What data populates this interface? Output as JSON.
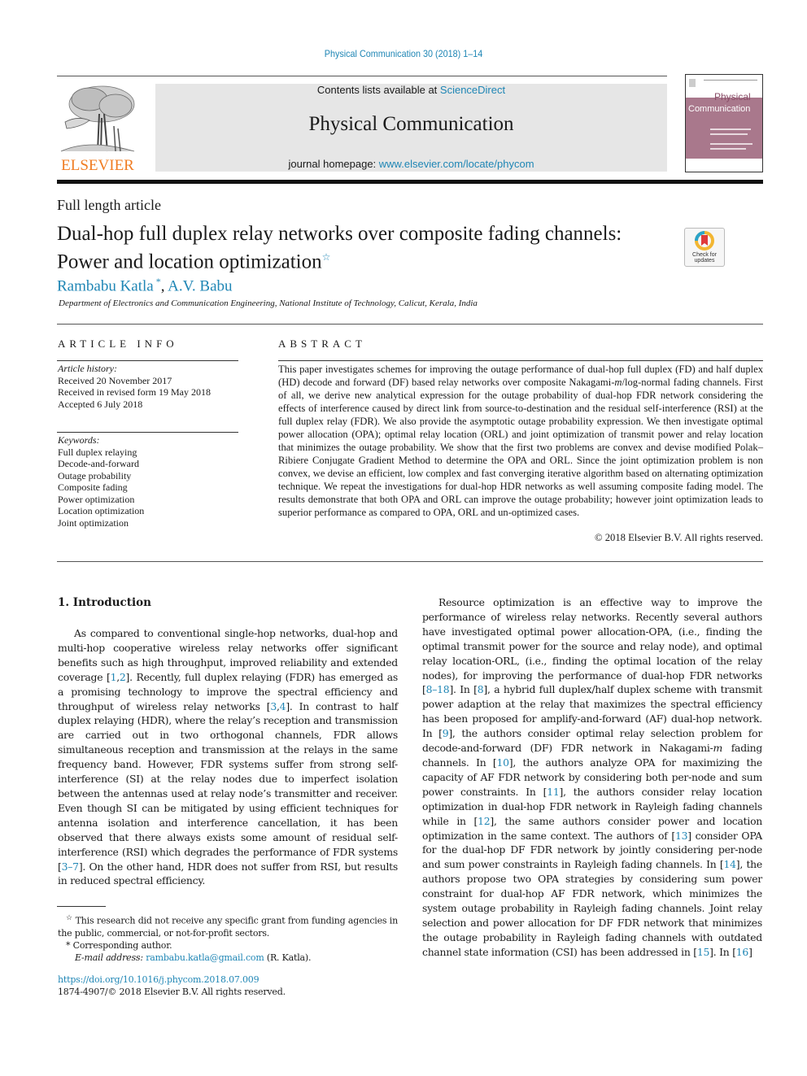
{
  "header": {
    "journal_ref": "Physical Communication 30 (2018) 1–14",
    "contents_prefix": "Contents lists available at ",
    "contents_link": "ScienceDirect",
    "journal_title": "Physical Communication",
    "homepage_prefix": "journal homepage: ",
    "homepage_link": "www.elsevier.com/locate/phycom",
    "publisher_logo_text": "ELSEVIER",
    "cover": {
      "title_line1": "Physical",
      "title_line2": "Communication"
    },
    "brand_color": "#f07c22",
    "link_color": "#1f86b5"
  },
  "article": {
    "type": "Full length article",
    "title_line1": "Dual-hop full duplex relay networks over composite fading channels:",
    "title_line2": "Power and location optimization",
    "title_footnote_mark": "☆",
    "check_updates_label_1": "Check for",
    "check_updates_label_2": "updates",
    "authors": [
      {
        "name": "Rambabu Katla",
        "mark": "*"
      },
      {
        "name": "A.V. Babu",
        "mark": ""
      }
    ],
    "author_separator": ", ",
    "affiliation": "Department of Electronics and Communication Engineering, National Institute of Technology, Calicut, Kerala, India"
  },
  "article_info": {
    "heading": "ARTICLE INFO",
    "history_label": "Article history:",
    "history": [
      "Received 20 November 2017",
      "Received in revised form 19 May 2018",
      "Accepted 6 July 2018"
    ],
    "keywords_label": "Keywords:",
    "keywords": [
      "Full duplex relaying",
      "Decode-and-forward",
      "Outage probability",
      "Composite fading",
      "Power optimization",
      "Location optimization",
      "Joint optimization"
    ]
  },
  "abstract": {
    "heading": "ABSTRACT",
    "text_part1": "This paper investigates schemes for improving the outage performance of dual-hop full duplex (FD) and half duplex (HD) decode and forward (DF) based relay networks over composite Nakagami-",
    "text_italic": "m",
    "text_part2": "/log-normal fading channels. First of all, we derive new analytical expression for the outage probability of dual-hop FDR network considering the effects of interference caused by direct link from source-to-destination and the residual self-interference (RSI) at the full duplex relay (FDR). We also provide the asymptotic outage probability expression. We then investigate optimal power allocation (OPA); optimal relay location (ORL) and joint optimization of transmit power and relay location that minimizes the outage probability. We show that the first two problems are convex and devise modified Polak–Ribiere Conjugate Gradient Method to determine the OPA and ORL. Since the joint optimization problem is non convex, we devise an efficient, low complex and fast converging iterative algorithm based on alternating optimization technique. We repeat the investigations for dual-hop HDR networks as well assuming composite fading model. The results demonstrate that both OPA and ORL can improve the outage probability; however joint optimization leads to superior performance as compared to OPA, ORL and un-optimized cases.",
    "copyright": "© 2018 Elsevier B.V. All rights reserved."
  },
  "introduction": {
    "heading": "1.  Introduction",
    "left_paragraph": [
      {
        "t": "As compared to conventional single-hop networks, dual-hop and multi-hop cooperative wireless relay networks offer significant benefits such as high throughput, improved reliability and extended coverage ["
      },
      {
        "ref": "1"
      },
      {
        "t": ","
      },
      {
        "ref": "2"
      },
      {
        "t": "]. Recently, full duplex relaying (FDR) has emerged as a promising technology to improve the spectral efficiency and throughput of wireless relay networks ["
      },
      {
        "ref": "3"
      },
      {
        "t": ","
      },
      {
        "ref": "4"
      },
      {
        "t": "]. In contrast to half duplex relaying (HDR), where the relay’s reception and transmission are carried out in two orthogonal channels, FDR allows simultaneous reception and transmission at the relays in the same frequency band. However, FDR systems suffer from strong self-interference (SI) at the relay nodes due to imperfect isolation between the antennas used at relay node’s transmitter and receiver. Even though SI can be mitigated by using efficient techniques for antenna isolation and interference cancellation, it has been observed that there always exists some amount of residual self-interference (RSI) which degrades the performance of FDR systems ["
      },
      {
        "ref": "3–7"
      },
      {
        "t": "]. On the other hand, HDR does not suffer from RSI, but results in reduced spectral efficiency."
      }
    ],
    "right_paragraph": [
      {
        "t": "Resource optimization is an effective way to improve the performance of wireless relay networks. Recently several authors have investigated optimal power allocation-OPA, (i.e., finding the optimal transmit power for the source and relay node), and optimal relay location-ORL, (i.e., finding the optimal location of the relay nodes), for improving the performance of dual-hop FDR networks ["
      },
      {
        "ref": "8–18"
      },
      {
        "t": "]. In ["
      },
      {
        "ref": "8"
      },
      {
        "t": "], a hybrid full duplex/half duplex scheme with transmit power adaption at the relay that maximizes the spectral efficiency has been proposed for amplify-and-forward (AF) dual-hop network. In ["
      },
      {
        "ref": "9"
      },
      {
        "t": "], the authors consider optimal relay selection problem for decode-and-forward (DF) FDR network in Nakagami-"
      },
      {
        "i": "m"
      },
      {
        "t": " fading channels. In ["
      },
      {
        "ref": "10"
      },
      {
        "t": "], the authors analyze OPA for maximizing the capacity of AF FDR network by considering both per-node and sum power constraints. In ["
      },
      {
        "ref": "11"
      },
      {
        "t": "], the authors consider relay location optimization in dual-hop FDR network in Rayleigh fading channels while in ["
      },
      {
        "ref": "12"
      },
      {
        "t": "], the same authors consider power and location optimization in the same context. The authors of ["
      },
      {
        "ref": "13"
      },
      {
        "t": "] consider OPA for the dual-hop DF FDR network by jointly considering per-node and sum power constraints in Rayleigh fading channels. In ["
      },
      {
        "ref": "14"
      },
      {
        "t": "], the authors propose two OPA strategies by considering sum power constraint for dual-hop AF FDR network, which minimizes the system outage probability in Rayleigh fading channels. Joint relay selection and power allocation for DF FDR network that minimizes the outage probability in Rayleigh fading channels with outdated channel state information (CSI) has been addressed in ["
      },
      {
        "ref": "15"
      },
      {
        "t": "]. In ["
      },
      {
        "ref": "16"
      },
      {
        "t": "]"
      }
    ]
  },
  "footnotes": {
    "funding_mark": "☆",
    "funding_text": "This research did not receive any specific grant from funding agencies in the public, commercial, or not-for-profit sectors.",
    "corresponding_mark": "*",
    "corresponding_text": "Corresponding author.",
    "email_label": "E-mail address:",
    "email": "rambabu.katla@gmail.com",
    "email_suffix": "(R. Katla).",
    "doi": "https://doi.org/10.1016/j.phycom.2018.07.009",
    "issn_copyright": "1874-4907/© 2018 Elsevier B.V. All rights reserved."
  }
}
